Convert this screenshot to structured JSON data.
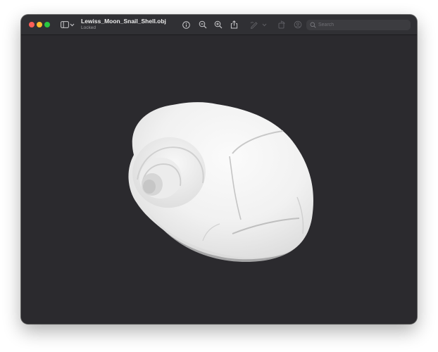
{
  "window": {
    "title": "Lewiss_Moon_Snail_Shell.obj",
    "subtitle": "Locked"
  },
  "toolbar": {
    "icons": [
      "sidebar-icon",
      "chevron-down-icon",
      "info-icon",
      "zoom-out-icon",
      "zoom-in-icon",
      "share-icon",
      "markup-icon",
      "rotate-icon",
      "crop-icon"
    ]
  },
  "search": {
    "placeholder": "Search",
    "value": ""
  },
  "viewer": {
    "model_name": "Lewiss_Moon_Snail_Shell",
    "background_color": "#2b2a2e",
    "model_color": "#f2f2f2"
  }
}
